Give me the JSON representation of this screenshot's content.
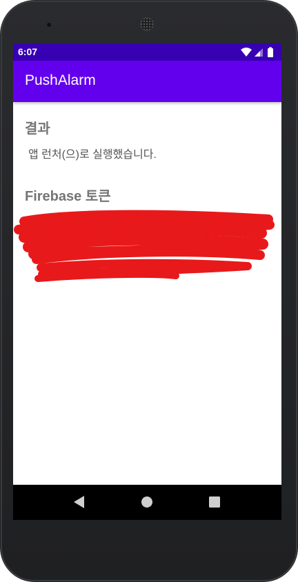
{
  "status_bar": {
    "time": "6:07",
    "icons": [
      "wifi-icon",
      "cellular-signal-icon",
      "battery-icon"
    ],
    "background": "#3700b3"
  },
  "app_bar": {
    "title": "PushAlarm",
    "background": "#6200ee"
  },
  "result_section": {
    "heading": "결과",
    "message": "앱 런처(으)로 실행했습니다."
  },
  "token_section": {
    "heading": "Firebase 토큰",
    "token_value": "",
    "redaction_color": "#e8191b"
  },
  "nav_bar": {
    "buttons": [
      "back-icon",
      "home-icon",
      "recents-icon"
    ]
  }
}
